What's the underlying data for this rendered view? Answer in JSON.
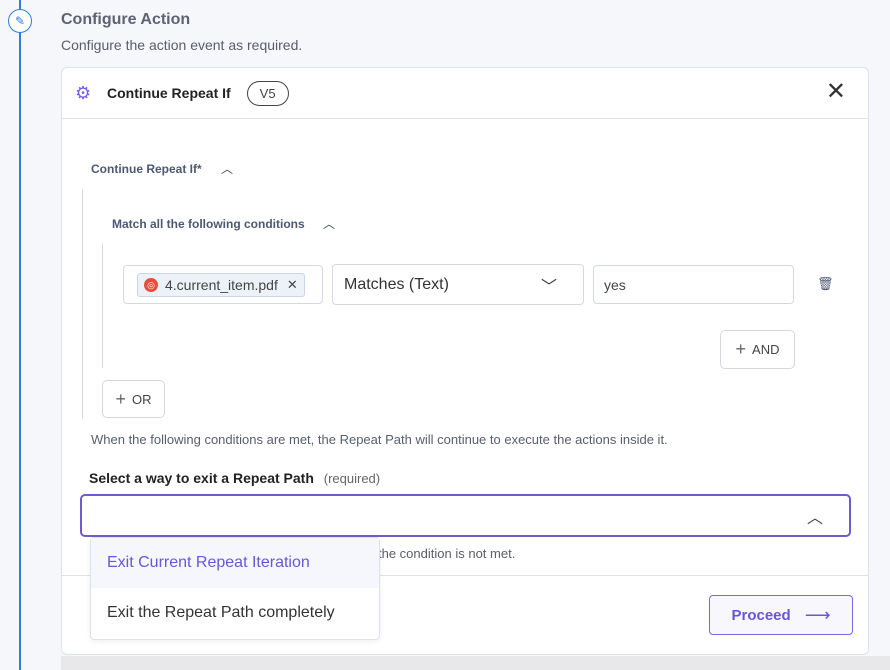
{
  "header": {
    "title": "Configure Action",
    "subtitle": "Configure the action event as required."
  },
  "card": {
    "title": "Continue Repeat If",
    "version": "V5"
  },
  "section": {
    "label": "Continue Repeat If*",
    "group_label": "Match all the following conditions"
  },
  "condition": {
    "field_chip": "4.current_item.pdf",
    "operator": "Matches (Text)",
    "value": "yes"
  },
  "buttons": {
    "and": "AND",
    "or": "OR",
    "proceed": "Proceed"
  },
  "note": "When the following conditions are met, the Repeat Path will continue to execute the actions inside it.",
  "exit": {
    "label": "Select a way to exit a Repeat Path",
    "required": "(required)",
    "hint_partial": "the condition is not met.",
    "options": [
      "Exit Current Repeat Iteration",
      "Exit the Repeat Path completely"
    ],
    "highlighted": "Exit Current Repeat Iteration"
  },
  "colors": {
    "accent": "#6a55d8",
    "timeline": "#2f7de1",
    "chip_icon": "#e94e3c"
  }
}
